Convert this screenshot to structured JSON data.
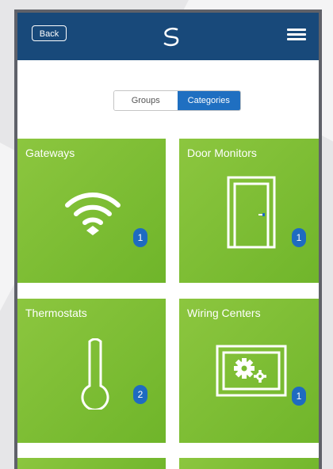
{
  "header": {
    "back_label": "Back"
  },
  "segmented": {
    "groups_label": "Groups",
    "categories_label": "Categories",
    "selected": "Categories"
  },
  "tiles": [
    {
      "title": "Gateways",
      "count": "1",
      "icon": "wifi-icon"
    },
    {
      "title": "Door Monitors",
      "count": "1",
      "icon": "door-icon"
    },
    {
      "title": "Thermostats",
      "count": "2",
      "icon": "thermometer-icon"
    },
    {
      "title": "Wiring Centers",
      "count": "1",
      "icon": "wiring-center-icon"
    }
  ],
  "colors": {
    "appbar": "#18497a",
    "tile_green": "#7dbd34",
    "accent_blue": "#1f6fc1"
  }
}
